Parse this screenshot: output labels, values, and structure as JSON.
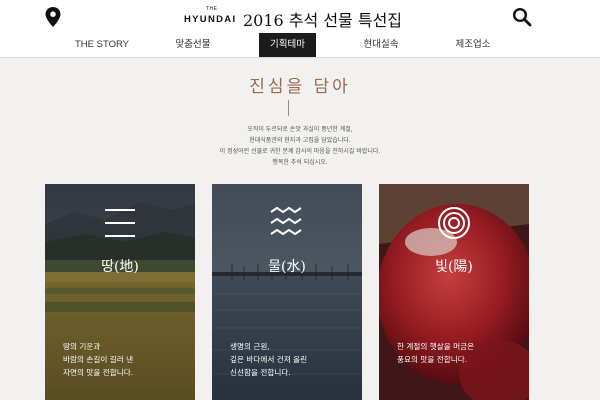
{
  "header": {
    "brand_the": "THE",
    "brand_name": "HYUNDAI",
    "title": "2016 추석 선물 특선집",
    "location_icon": "map-pin-icon",
    "search_icon": "search-icon"
  },
  "nav": {
    "items": [
      {
        "label": "THE STORY"
      },
      {
        "label": "맞춤선물"
      },
      {
        "label": "기획테마"
      },
      {
        "label": "현대실속"
      },
      {
        "label": "제조업소"
      }
    ],
    "active": "기획테마"
  },
  "main": {
    "headline": "진심을 담아",
    "intro_lines": [
      "오직이 두르되로 손맛 과실이 풍년한 계절,",
      "현대식품관의 현지과 고집을 담았습니다.",
      "이 정성어린 선물로 귀한 분께 감사의 마음을 전하시길 바랍니다.",
      "행복한 추석 되십시오."
    ]
  },
  "cards": [
    {
      "title": "땅(地)",
      "icon": "horizontal-lines-icon",
      "desc": [
        "땅의 기운과",
        "바람의 손길이 길러 낸",
        "자연의 맛을 전합니다."
      ]
    },
    {
      "title": "물(水)",
      "icon": "waves-icon",
      "desc": [
        "생명의 근원,",
        "깊은 바다에서 건져 올린",
        "신선함을 전합니다."
      ]
    },
    {
      "title": "빛(陽)",
      "icon": "concentric-circles-icon",
      "desc": [
        "한 계절의 햇살을 머금은",
        "풍요의 맛을 전합니다."
      ]
    }
  ],
  "colors": {
    "accent": "#9a6a4c",
    "nav_active_bg": "#1b1b1b",
    "page_bg": "#f2f1ef"
  }
}
